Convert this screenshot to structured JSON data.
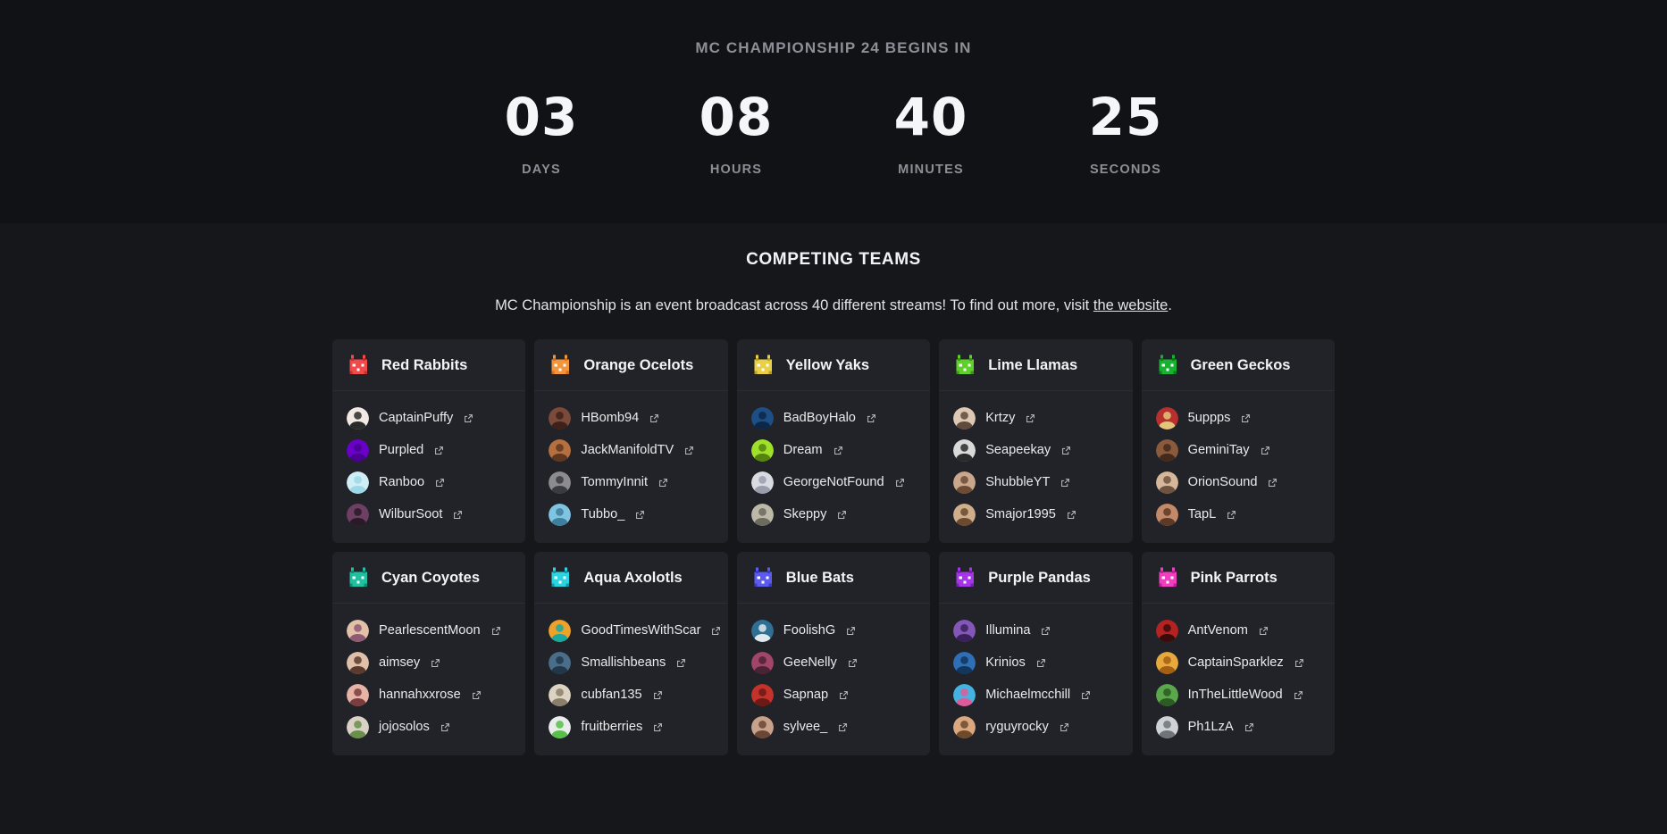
{
  "countdown": {
    "title": "MC CHAMPIONSHIP 24 BEGINS IN",
    "units": [
      {
        "value": "03",
        "label": "DAYS"
      },
      {
        "value": "08",
        "label": "HOURS"
      },
      {
        "value": "40",
        "label": "MINUTES"
      },
      {
        "value": "25",
        "label": "SECONDS"
      }
    ]
  },
  "teams_section": {
    "heading": "COMPETING TEAMS",
    "description_before": "MC Championship is an event broadcast across 40 different streams! To find out more, visit ",
    "link_text": "the website",
    "description_after": ".",
    "external_link_icon": "external-link-icon",
    "teams": [
      {
        "name": "Red Rabbits",
        "emblem": "rabbit-icon",
        "color": "#f04a4a",
        "accent": "#c62f2f",
        "players": [
          {
            "name": "CaptainPuffy",
            "avatar_colors": [
              "#f3e9e4",
              "#2b2b2b"
            ]
          },
          {
            "name": "Purpled",
            "avatar_colors": [
              "#6a00c8",
              "#4a0090"
            ]
          },
          {
            "name": "Ranboo",
            "avatar_colors": [
              "#cfeef5",
              "#9ed8e6"
            ]
          },
          {
            "name": "WilburSoot",
            "avatar_colors": [
              "#6d3f62",
              "#2a1a28"
            ]
          }
        ]
      },
      {
        "name": "Orange Ocelots",
        "emblem": "ocelot-icon",
        "color": "#f2953c",
        "accent": "#d2701b",
        "players": [
          {
            "name": "HBomb94",
            "avatar_colors": [
              "#7c4a3a",
              "#3d221b"
            ]
          },
          {
            "name": "JackManifoldTV",
            "avatar_colors": [
              "#b6703f",
              "#5e3720"
            ]
          },
          {
            "name": "TommyInnit",
            "avatar_colors": [
              "#8b8b90",
              "#3a3a40"
            ]
          },
          {
            "name": "Tubbo_",
            "avatar_colors": [
              "#7fc4e0",
              "#3f7f9b"
            ]
          }
        ]
      },
      {
        "name": "Yellow Yaks",
        "emblem": "yak-icon",
        "color": "#e9cf45",
        "accent": "#b8a022",
        "players": [
          {
            "name": "BadBoyHalo",
            "avatar_colors": [
              "#1d4f86",
              "#0d2747"
            ]
          },
          {
            "name": "Dream",
            "avatar_colors": [
              "#9fe02a",
              "#56820f"
            ]
          },
          {
            "name": "GeorgeNotFound",
            "avatar_colors": [
              "#d9dbe2",
              "#9a9dab"
            ]
          },
          {
            "name": "Skeppy",
            "avatar_colors": [
              "#bdb9a8",
              "#6d6a5e"
            ]
          }
        ]
      },
      {
        "name": "Lime Llamas",
        "emblem": "llama-icon",
        "color": "#5ed02a",
        "accent": "#3d9415",
        "players": [
          {
            "name": "Krtzy",
            "avatar_colors": [
              "#ddc8b5",
              "#5f4a3c"
            ]
          },
          {
            "name": "Seapeekay",
            "avatar_colors": [
              "#d9d9d9",
              "#2a2a2a"
            ]
          },
          {
            "name": "ShubbleYT",
            "avatar_colors": [
              "#c9a78c",
              "#6d4b36"
            ]
          },
          {
            "name": "Smajor1995",
            "avatar_colors": [
              "#cfae8c",
              "#6b4a2d"
            ]
          }
        ]
      },
      {
        "name": "Green Geckos",
        "emblem": "gecko-icon",
        "color": "#18b131",
        "accent": "#0e7a20",
        "players": [
          {
            "name": "5uppps",
            "avatar_colors": [
              "#b8302d",
              "#e3c67a"
            ]
          },
          {
            "name": "GeminiTay",
            "avatar_colors": [
              "#8a5a3d",
              "#432a1b"
            ]
          },
          {
            "name": "OrionSound",
            "avatar_colors": [
              "#d6b79a",
              "#6d5340"
            ]
          },
          {
            "name": "TapL",
            "avatar_colors": [
              "#c38a6a",
              "#5d3a27"
            ]
          }
        ]
      },
      {
        "name": "Cyan Coyotes",
        "emblem": "coyote-icon",
        "color": "#1fbfa0",
        "accent": "#0f8b74",
        "players": [
          {
            "name": "PearlescentMoon",
            "avatar_colors": [
              "#e3c0a8",
              "#8d5b73"
            ]
          },
          {
            "name": "aimsey",
            "avatar_colors": [
              "#e0c0a8",
              "#5a3b2c"
            ]
          },
          {
            "name": "hannahxxrose",
            "avatar_colors": [
              "#e6b4a6",
              "#7a3c3c"
            ]
          },
          {
            "name": "jojosolos",
            "avatar_colors": [
              "#d9d1c5",
              "#6a8f4a"
            ]
          }
        ]
      },
      {
        "name": "Aqua Axolotls",
        "emblem": "axolotl-icon",
        "color": "#2ad4e0",
        "accent": "#1597a3",
        "players": [
          {
            "name": "GoodTimesWithScar",
            "avatar_colors": [
              "#f0a129",
              "#1aa9a0"
            ]
          },
          {
            "name": "Smallishbeans",
            "avatar_colors": [
              "#4a6d8a",
              "#23374a"
            ]
          },
          {
            "name": "cubfan135",
            "avatar_colors": [
              "#dcd3c2",
              "#8a7f6a"
            ]
          },
          {
            "name": "fruitberries",
            "avatar_colors": [
              "#e8ecea",
              "#58c04a"
            ]
          }
        ]
      },
      {
        "name": "Blue Bats",
        "emblem": "bat-icon",
        "color": "#5b5bf0",
        "accent": "#3a3ac6",
        "players": [
          {
            "name": "FoolishG",
            "avatar_colors": [
              "#2f6f93",
              "#dfe9ee"
            ]
          },
          {
            "name": "GeeNelly",
            "avatar_colors": [
              "#a1456a",
              "#4c2334"
            ]
          },
          {
            "name": "Sapnap",
            "avatar_colors": [
              "#c4332b",
              "#6d1a16"
            ]
          },
          {
            "name": "sylvee_",
            "avatar_colors": [
              "#c8a18a",
              "#6a4636"
            ]
          }
        ]
      },
      {
        "name": "Purple Pandas",
        "emblem": "panda-icon",
        "color": "#a435e8",
        "accent": "#7a1eb0",
        "players": [
          {
            "name": "Illumina",
            "avatar_colors": [
              "#8257b8",
              "#3b2159"
            ]
          },
          {
            "name": "Krinios",
            "avatar_colors": [
              "#2e6fb5",
              "#13365c"
            ]
          },
          {
            "name": "Michaelmcchill",
            "avatar_colors": [
              "#45b3e0",
              "#e05a9a"
            ]
          },
          {
            "name": "ryguyrocky",
            "avatar_colors": [
              "#d9a87e",
              "#6d4a2c"
            ]
          }
        ]
      },
      {
        "name": "Pink Parrots",
        "emblem": "parrot-icon",
        "color": "#ef3fc0",
        "accent": "#bf1e95",
        "players": [
          {
            "name": "AntVenom",
            "avatar_colors": [
              "#b52222",
              "#3a0b0b"
            ]
          },
          {
            "name": "CaptainSparklez",
            "avatar_colors": [
              "#e8a93c",
              "#a35f12"
            ]
          },
          {
            "name": "InTheLittleWood",
            "avatar_colors": [
              "#5aa84a",
              "#2c5b23"
            ]
          },
          {
            "name": "Ph1LzA",
            "avatar_colors": [
              "#cfd2d6",
              "#6e7479"
            ]
          }
        ]
      }
    ]
  }
}
